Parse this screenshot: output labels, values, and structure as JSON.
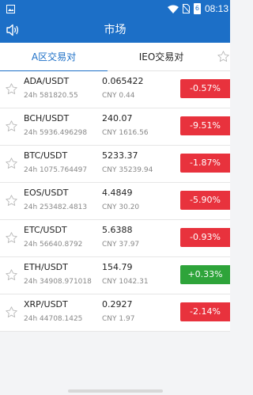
{
  "status_bar": {
    "time": "08:13",
    "battery_label": "6"
  },
  "header": {
    "title": "市场"
  },
  "tabs": [
    {
      "label": "A区交易对",
      "active": true
    },
    {
      "label": "IEO交易对",
      "active": false
    }
  ],
  "colors": {
    "brand": "#1c6fc7",
    "down": "#e8323d",
    "up": "#2ea43a"
  },
  "markets": [
    {
      "pair": "ADA/USDT",
      "volume": "24h 581820.55",
      "price": "0.065422",
      "cny": "CNY 0.44",
      "change": "-0.57%",
      "trend": "down"
    },
    {
      "pair": "BCH/USDT",
      "volume": "24h 5936.496298",
      "price": "240.07",
      "cny": "CNY 1616.56",
      "change": "-9.51%",
      "trend": "down"
    },
    {
      "pair": "BTC/USDT",
      "volume": "24h 1075.764497",
      "price": "5233.37",
      "cny": "CNY 35239.94",
      "change": "-1.87%",
      "trend": "down"
    },
    {
      "pair": "EOS/USDT",
      "volume": "24h 253482.4813",
      "price": "4.4849",
      "cny": "CNY 30.20",
      "change": "-5.90%",
      "trend": "down"
    },
    {
      "pair": "ETC/USDT",
      "volume": "24h 56640.8792",
      "price": "5.6388",
      "cny": "CNY 37.97",
      "change": "-0.93%",
      "trend": "down"
    },
    {
      "pair": "ETH/USDT",
      "volume": "24h 34908.971018",
      "price": "154.79",
      "cny": "CNY 1042.31",
      "change": "+0.33%",
      "trend": "up"
    },
    {
      "pair": "XRP/USDT",
      "volume": "24h 44708.1425",
      "price": "0.2927",
      "cny": "CNY 1.97",
      "change": "-2.14%",
      "trend": "down"
    }
  ]
}
